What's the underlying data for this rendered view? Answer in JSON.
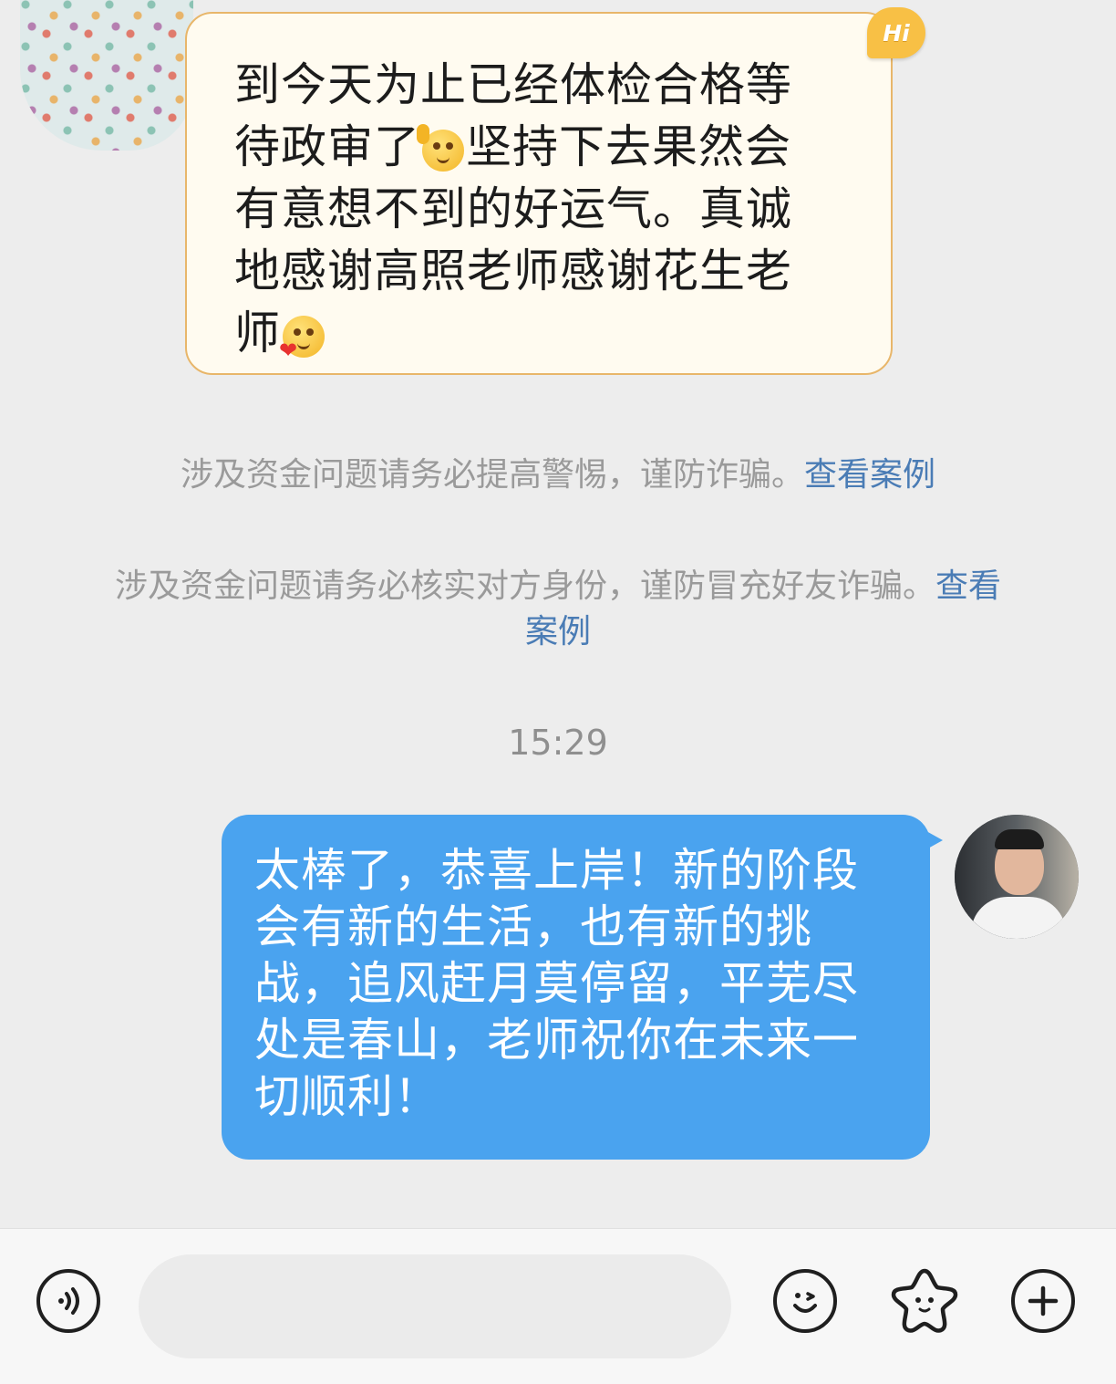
{
  "incoming": {
    "badge": "Hi",
    "text_part1": "到今天为止已经体检合格等\n待政审了",
    "text_part2": "坚持下去果然会\n有意想不到的好运气。真诚\n地感谢高照老师感谢花生老\n师",
    "emoji_1": "raising-hand-emoji",
    "emoji_2": "blushing-heart-emoji"
  },
  "notices": [
    {
      "text": "涉及资金问题请务必提高警惕，谨防诈骗。",
      "link": "查看案例"
    },
    {
      "text": "涉及资金问题请务必核实对方身份，谨防冒充好友诈骗。",
      "link": "查看案例"
    }
  ],
  "timestamp": "15:29",
  "outgoing": {
    "text": "太棒了，恭喜上岸！新的阶段会有新的生活，也有新的挑战，追风赶月莫停留，平芜尽处是春山，老师祝你在未来一切顺利！"
  },
  "input_bar": {
    "placeholder": "",
    "voice_icon": "voice-icon",
    "emoji_icon": "emoji-icon",
    "favorite_icon": "favorite-sticker-icon",
    "plus_icon": "plus-icon"
  },
  "colors": {
    "outgoing_bubble": "#4aa3ef",
    "incoming_bubble": "#fffbf0",
    "incoming_border": "#e8b66a",
    "link": "#4a7cb5",
    "background": "#ededed"
  }
}
